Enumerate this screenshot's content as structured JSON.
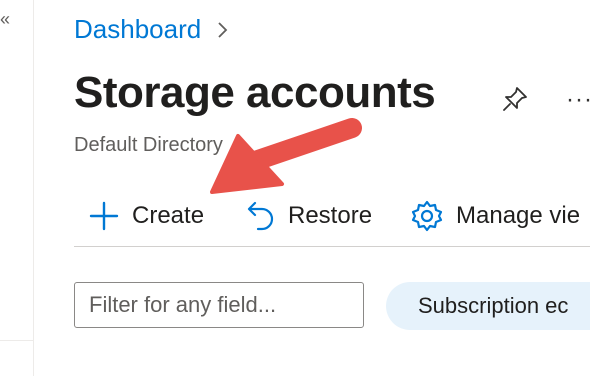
{
  "nav": {
    "collapse_icon": "«"
  },
  "breadcrumb": {
    "items": [
      "Dashboard"
    ]
  },
  "header": {
    "title": "Storage accounts",
    "subtitle": "Default Directory",
    "more_icon": "···"
  },
  "toolbar": {
    "create_label": "Create",
    "restore_label": "Restore",
    "manage_view_label": "Manage vie"
  },
  "filters": {
    "search_placeholder": "Filter for any field...",
    "subscription_pill": "Subscription ec"
  },
  "colors": {
    "accent": "#0078d4",
    "annotation_arrow": "#e8524a",
    "pill_background": "#e6f2fb"
  },
  "icons": [
    "double-chevron-left-icon",
    "chevron-right-icon",
    "pin-icon",
    "more-icon",
    "plus-icon",
    "undo-icon",
    "gear-icon"
  ]
}
